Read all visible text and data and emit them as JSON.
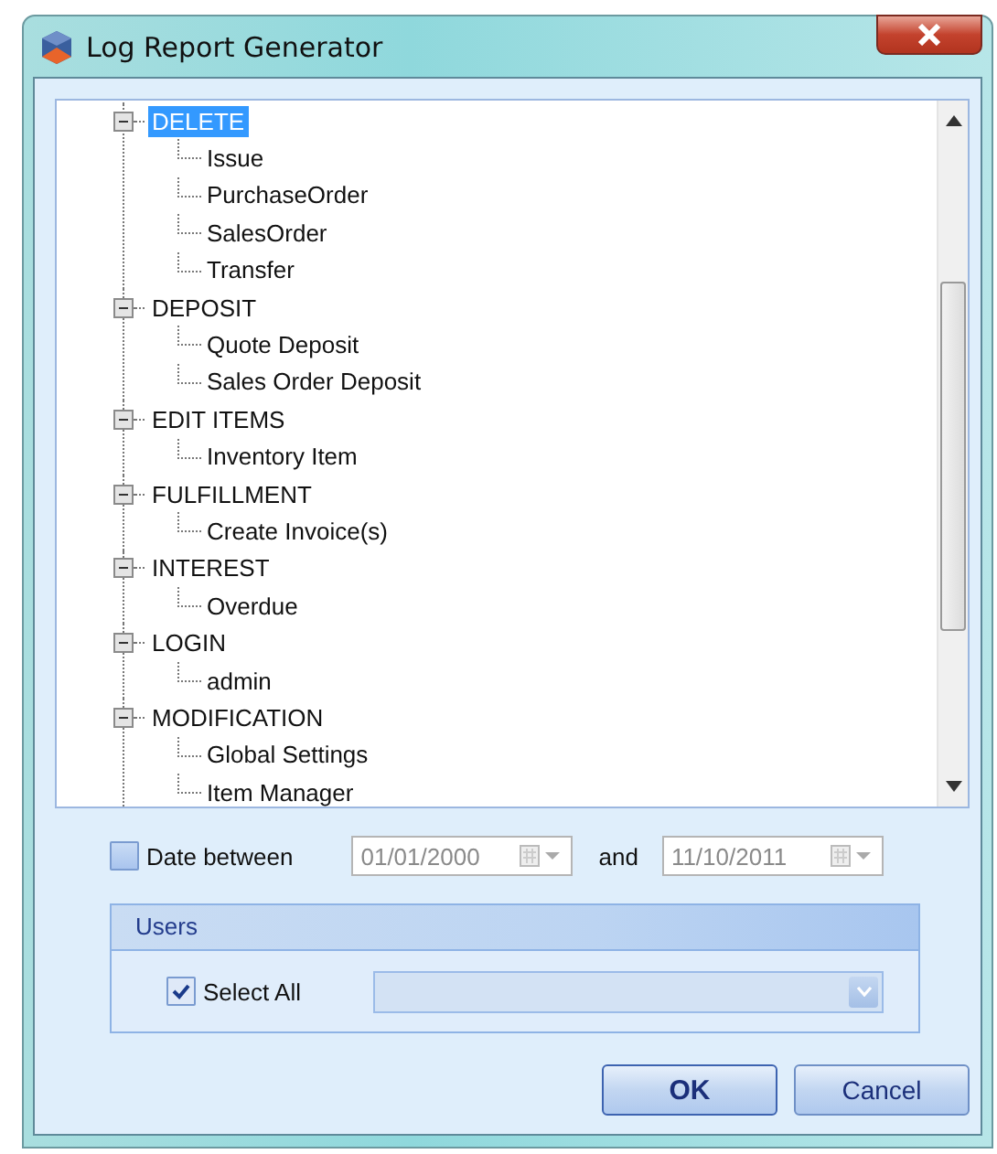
{
  "window": {
    "title": "Log Report Generator"
  },
  "tree": {
    "items": [
      {
        "label": "DELETE",
        "expanded": true,
        "selected": true,
        "children": [
          {
            "label": "Issue",
            "selected": false
          },
          {
            "label": "PurchaseOrder",
            "selected": false
          },
          {
            "label": "SalesOrder",
            "selected": false
          },
          {
            "label": "Transfer",
            "selected": false
          }
        ]
      },
      {
        "label": "DEPOSIT",
        "expanded": true,
        "selected": false,
        "children": [
          {
            "label": "Quote Deposit",
            "selected": false
          },
          {
            "label": "Sales Order Deposit",
            "selected": false
          }
        ]
      },
      {
        "label": "EDIT ITEMS",
        "expanded": true,
        "selected": false,
        "children": [
          {
            "label": "Inventory Item",
            "selected": false
          }
        ]
      },
      {
        "label": "FULFILLMENT",
        "expanded": true,
        "selected": false,
        "children": [
          {
            "label": "Create Invoice(s)",
            "selected": false
          }
        ]
      },
      {
        "label": "INTEREST",
        "expanded": true,
        "selected": false,
        "children": [
          {
            "label": "Overdue",
            "selected": false
          }
        ]
      },
      {
        "label": "LOGIN",
        "expanded": true,
        "selected": false,
        "children": [
          {
            "label": "admin",
            "selected": false
          }
        ]
      },
      {
        "label": "MODIFICATION",
        "expanded": true,
        "selected": false,
        "children": [
          {
            "label": "Global Settings",
            "selected": false
          },
          {
            "label": "Item Manager",
            "selected": false
          }
        ]
      }
    ]
  },
  "date_filter": {
    "label": "Date between",
    "checked": false,
    "from": {
      "value": "01/01/2000",
      "disabled": true
    },
    "joiner": "and",
    "to": {
      "value": "11/10/2011",
      "disabled": true
    }
  },
  "users": {
    "title": "Users",
    "select_all": {
      "label": "Select All",
      "checked": true
    },
    "user_combo": {
      "disabled": true
    }
  },
  "buttons": [
    {
      "label": "OK",
      "default": true
    },
    {
      "label": "Cancel",
      "default": false
    }
  ]
}
